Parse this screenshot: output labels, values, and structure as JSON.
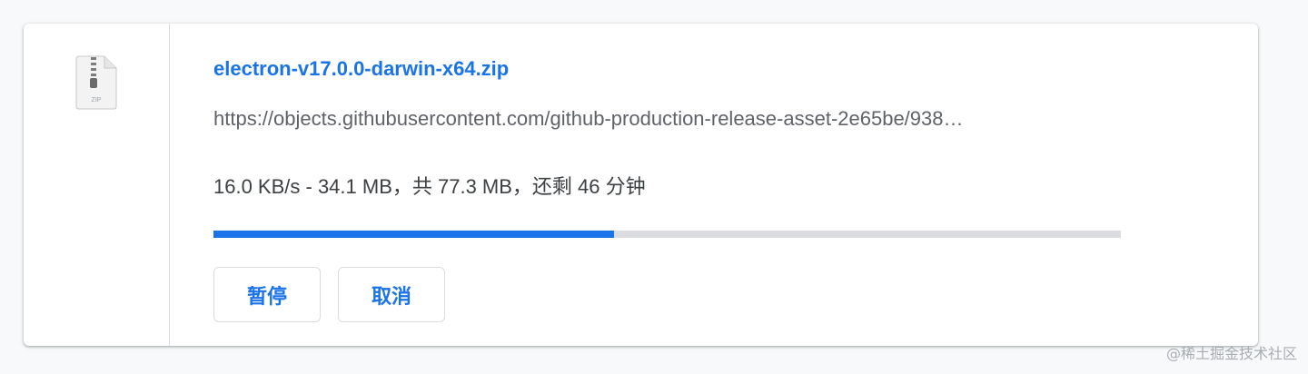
{
  "download": {
    "file_icon": "zip-file-icon",
    "file_icon_label": "ZIP",
    "file_name": "electron-v17.0.0-darwin-x64.zip",
    "url": "https://objects.githubusercontent.com/github-production-release-asset-2e65be/938…",
    "status": "16.0 KB/s - 34.1 MB，共 77.3 MB，还剩 46 分钟",
    "progress_fraction": 0.441,
    "buttons": {
      "pause_label": "暂停",
      "cancel_label": "取消"
    }
  },
  "watermark": "@稀土掘金技术社区",
  "colors": {
    "accent": "#1a73e8",
    "progress_track": "#dadce0",
    "text_primary": "#3c4043",
    "text_secondary": "#5f6368"
  }
}
